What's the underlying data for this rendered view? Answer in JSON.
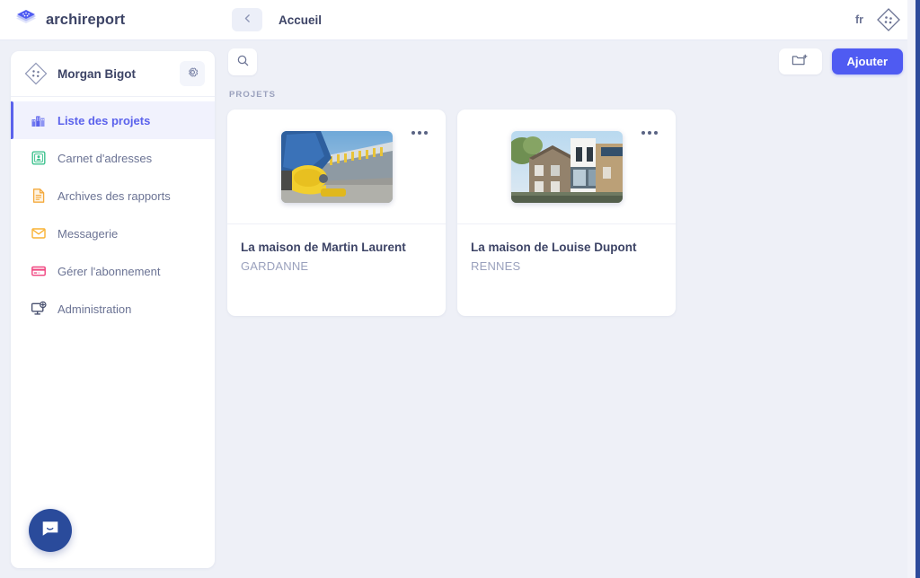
{
  "brand": {
    "name": "archireport",
    "logo_icon": "diamond-stack-logo"
  },
  "header": {
    "back_icon": "chevron-left-icon",
    "breadcrumb": "Accueil",
    "language": "fr",
    "avatar_icon": "diamond-avatar-icon"
  },
  "sidebar": {
    "user": {
      "name": "Morgan Bigot",
      "avatar_icon": "diamond-avatar-icon",
      "settings_icon": "gear-icon"
    },
    "items": [
      {
        "label": "Liste des projets",
        "icon": "buildings-icon",
        "active": true
      },
      {
        "label": "Carnet d'adresses",
        "icon": "contact-card-icon",
        "active": false
      },
      {
        "label": "Archives des rapports",
        "icon": "document-icon",
        "active": false
      },
      {
        "label": "Messagerie",
        "icon": "envelope-icon",
        "active": false
      },
      {
        "label": "Gérer l'abonnement",
        "icon": "credit-card-icon",
        "active": false
      },
      {
        "label": "Administration",
        "icon": "monitor-add-icon",
        "active": false
      }
    ],
    "chat_launcher_icon": "chat-bubble-icon"
  },
  "toolbar": {
    "search_icon": "search-icon",
    "new_folder_icon": "folder-plus-icon",
    "add_label": "Ajouter"
  },
  "main": {
    "section_label": "PROJETS",
    "projects": [
      {
        "title": "La maison de Martin Laurent",
        "city": "GARDANNE",
        "thumb": "construction-worker-photo",
        "menu_icon": "more-options-icon"
      },
      {
        "title": "La maison de Louise Dupont",
        "city": "RENNES",
        "thumb": "modern-house-photo",
        "menu_icon": "more-options-icon"
      }
    ]
  },
  "colors": {
    "accent": "#4f5bf2",
    "accent_soft": "#f1f2fd",
    "text_primary": "#3d4466",
    "text_muted": "#9aa1bd",
    "page_bg": "#eef0f7",
    "chat_blue": "#2a4b9b",
    "edge_strip": "#2e4b9b"
  }
}
